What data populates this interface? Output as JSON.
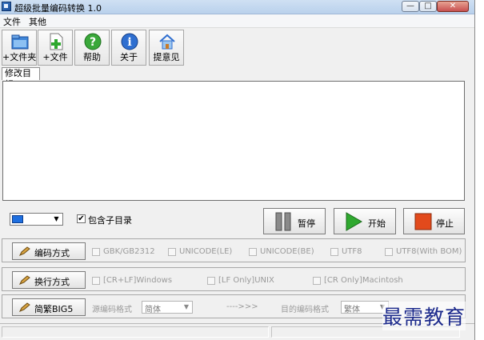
{
  "window": {
    "title": "超级批量编码转换 1.0",
    "minimize": "—",
    "maximize": "□",
    "close": "✕"
  },
  "menu": [
    "文件",
    "其他"
  ],
  "toolbar": [
    {
      "label": "+文件夹",
      "icon": "add-folder-icon"
    },
    {
      "label": "+文件",
      "icon": "add-file-icon"
    },
    {
      "label": "帮助",
      "icon": "help-icon"
    },
    {
      "label": "关于",
      "icon": "info-icon"
    },
    {
      "label": "提意见",
      "icon": "home-icon"
    }
  ],
  "tab": {
    "label": "修改目标"
  },
  "controls": {
    "include_subdirs_label": "包含子目录",
    "include_subdirs_checked": "✔",
    "combo_arrow": "▼",
    "pause_label": "暂停",
    "start_label": "开始",
    "stop_label": "停止"
  },
  "encoding_row": {
    "button": "编码方式",
    "options": [
      "GBK/GB2312",
      "UNICODE(LE)",
      "UNICODE(BE)",
      "UTF8",
      "UTF8(With BOM)"
    ]
  },
  "newline_row": {
    "button": "换行方式",
    "options": [
      "[CR+LF]Windows",
      "[LF Only]UNIX",
      "[CR Only]Macintosh"
    ]
  },
  "big5_row": {
    "button": "简繁BIG5",
    "source_label": "源编码格式",
    "source_value": "简体",
    "arrow": "---->>>",
    "target_label": "目的编码格式",
    "target_value": "繁体"
  },
  "watermark": "最需教育",
  "colors": {
    "accent_blue": "#1e6fe0",
    "start_green": "#2fa82f",
    "stop_red": "#e24a1c"
  }
}
